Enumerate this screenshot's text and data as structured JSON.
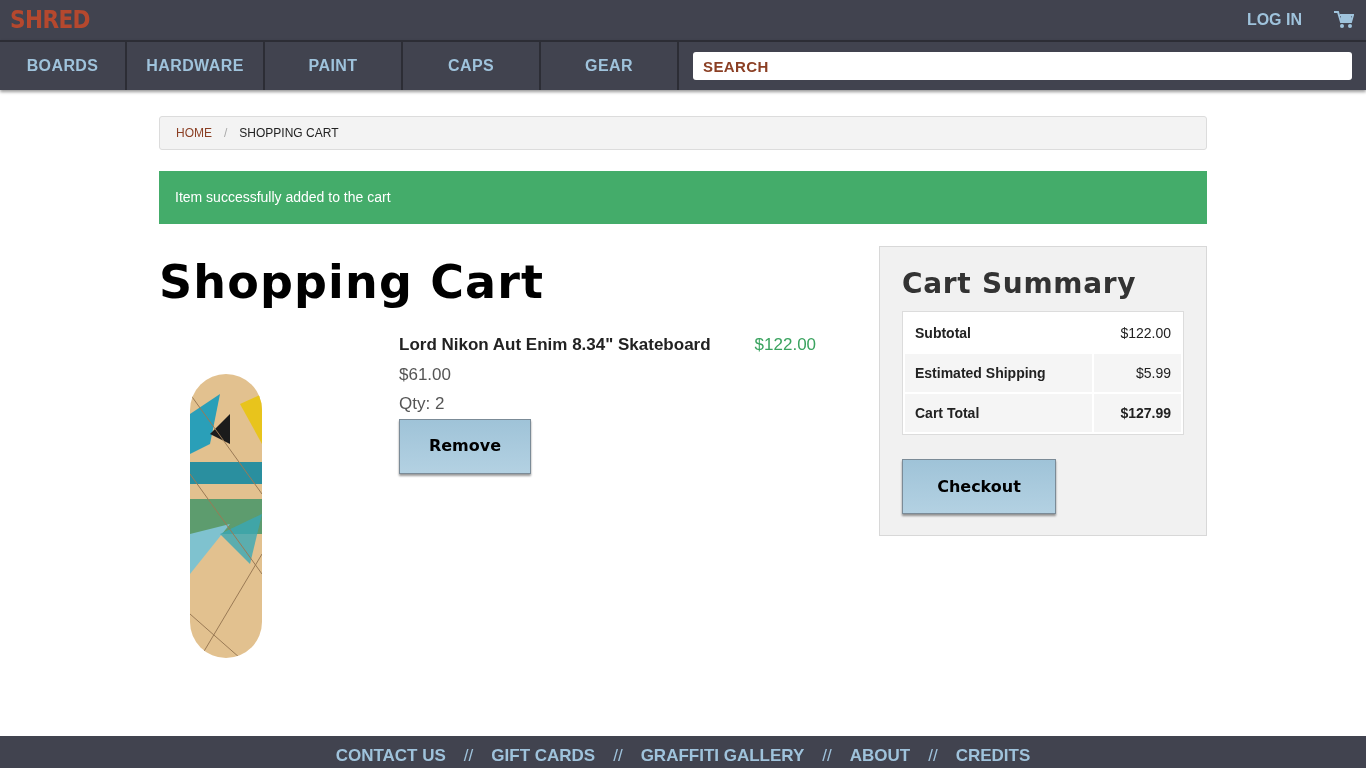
{
  "header": {
    "logo": "SHRED",
    "login": "LOG IN"
  },
  "nav": {
    "items": [
      {
        "label": "BOARDS"
      },
      {
        "label": "HARDWARE"
      },
      {
        "label": "PAINT"
      },
      {
        "label": "CAPS"
      },
      {
        "label": "GEAR"
      }
    ],
    "search": {
      "placeholder": "SEARCH"
    }
  },
  "breadcrumb": [
    {
      "label": "HOME",
      "kind": "link"
    },
    {
      "label": "/",
      "kind": "separator"
    },
    {
      "label": "SHOPPING CART",
      "kind": "current"
    }
  ],
  "alert": "Item successfully added to the cart",
  "title": "Shopping Cart",
  "items": [
    {
      "name": "Lord Nikon Aut Enim 8.34\" Skateboard",
      "total": "$122.00",
      "price": "$61.00",
      "qty": "Qty: 2",
      "remove": "Remove"
    }
  ],
  "summary": {
    "title": "Cart Summary",
    "rows": [
      {
        "label": "Subtotal",
        "value": "$122.00",
        "emphasis": false
      },
      {
        "label": "Estimated Shipping",
        "value": "$5.99",
        "emphasis": false
      },
      {
        "label": "Cart Total",
        "value": "$127.99",
        "emphasis": true
      }
    ],
    "checkout": "Checkout"
  },
  "footer": [
    {
      "kind": "link",
      "label": "CONTACT US"
    },
    {
      "kind": "separator",
      "label": "//"
    },
    {
      "kind": "link",
      "label": "GIFT CARDS"
    },
    {
      "kind": "separator",
      "label": "//"
    },
    {
      "kind": "link",
      "label": "GRAFFITI GALLERY"
    },
    {
      "kind": "separator",
      "label": "//"
    },
    {
      "kind": "link",
      "label": "ABOUT"
    },
    {
      "kind": "separator",
      "label": "//"
    },
    {
      "kind": "link",
      "label": "CREDITS"
    }
  ]
}
